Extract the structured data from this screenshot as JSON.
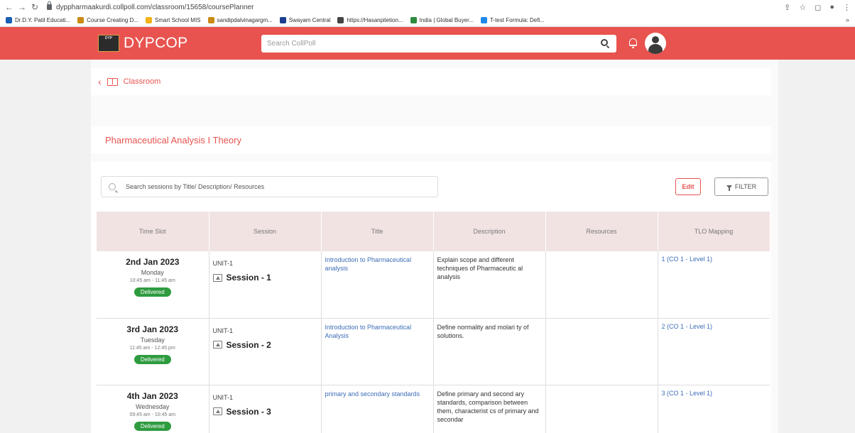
{
  "browser": {
    "url": "dyppharmaakurdi.collpoll.com/classroom/15658/coursePlanner",
    "bookmarks": [
      {
        "label": "Dr.D.Y. Patil Educati...",
        "color": "#1a5fb4"
      },
      {
        "label": "Course Creating D...",
        "color": "#c98a16"
      },
      {
        "label": "Smart School MIS",
        "color": "#f2b21c"
      },
      {
        "label": "sandipdalvinagargm...",
        "color": "#c98a16"
      },
      {
        "label": "Swayam Central",
        "color": "#1a3d8f"
      },
      {
        "label": "https://Hasanpiletion...",
        "color": "#444444"
      },
      {
        "label": "India | Global Buyer...",
        "color": "#2e8b3d"
      },
      {
        "label": "T-test Formula: Defi...",
        "color": "#1e88e5"
      }
    ],
    "more": "»"
  },
  "header": {
    "logo_mark": "DYP",
    "brand": "DYPCOP",
    "search_placeholder": "Search CollPoll",
    "accent": "#e8534f"
  },
  "breadcrumb": {
    "label": "Classroom"
  },
  "course": {
    "title": "Pharmaceutical Analysis I Theory"
  },
  "toolbar": {
    "search_placeholder": "Search sessions by Title/ Description/ Resources",
    "edit_label": "Edit",
    "filter_label": "FILTER"
  },
  "table": {
    "columns": [
      "Time Slot",
      "Session",
      "Title",
      "Description",
      "Resources",
      "TLO Mapping"
    ],
    "rows": [
      {
        "date": "2nd Jan 2023",
        "day": "Monday",
        "time": "10:45 am - 11:45 am",
        "status": "Delivered",
        "unit": "UNIT-1",
        "session": "Session - 1",
        "title": "Introduction to Pharmaceutical analysis",
        "description": "Explain scope and different techniques of Pharmaceutic al analysis",
        "resources": "",
        "tlo": "1 (CO 1 - Level 1)"
      },
      {
        "date": "3rd Jan 2023",
        "day": "Tuesday",
        "time": "11:45 am - 12:45 pm",
        "status": "Delivered",
        "unit": "UNIT-1",
        "session": "Session - 2",
        "title": "Introduction to Pharmaceutical Analysis",
        "description": "Define normality and molari ty of solutions.",
        "resources": "",
        "tlo": "2 (CO 1 - Level 1)"
      },
      {
        "date": "4th Jan 2023",
        "day": "Wednesday",
        "time": "09:45 am - 10:45 am",
        "status": "Delivered",
        "unit": "UNIT-1",
        "session": "Session - 3",
        "title": "primary and secondary standards",
        "description": "Define primary and second ary standards, comparison between them, characterist cs of primary and secondar",
        "resources": "",
        "tlo": "3 (CO 1 - Level 1)"
      }
    ]
  }
}
